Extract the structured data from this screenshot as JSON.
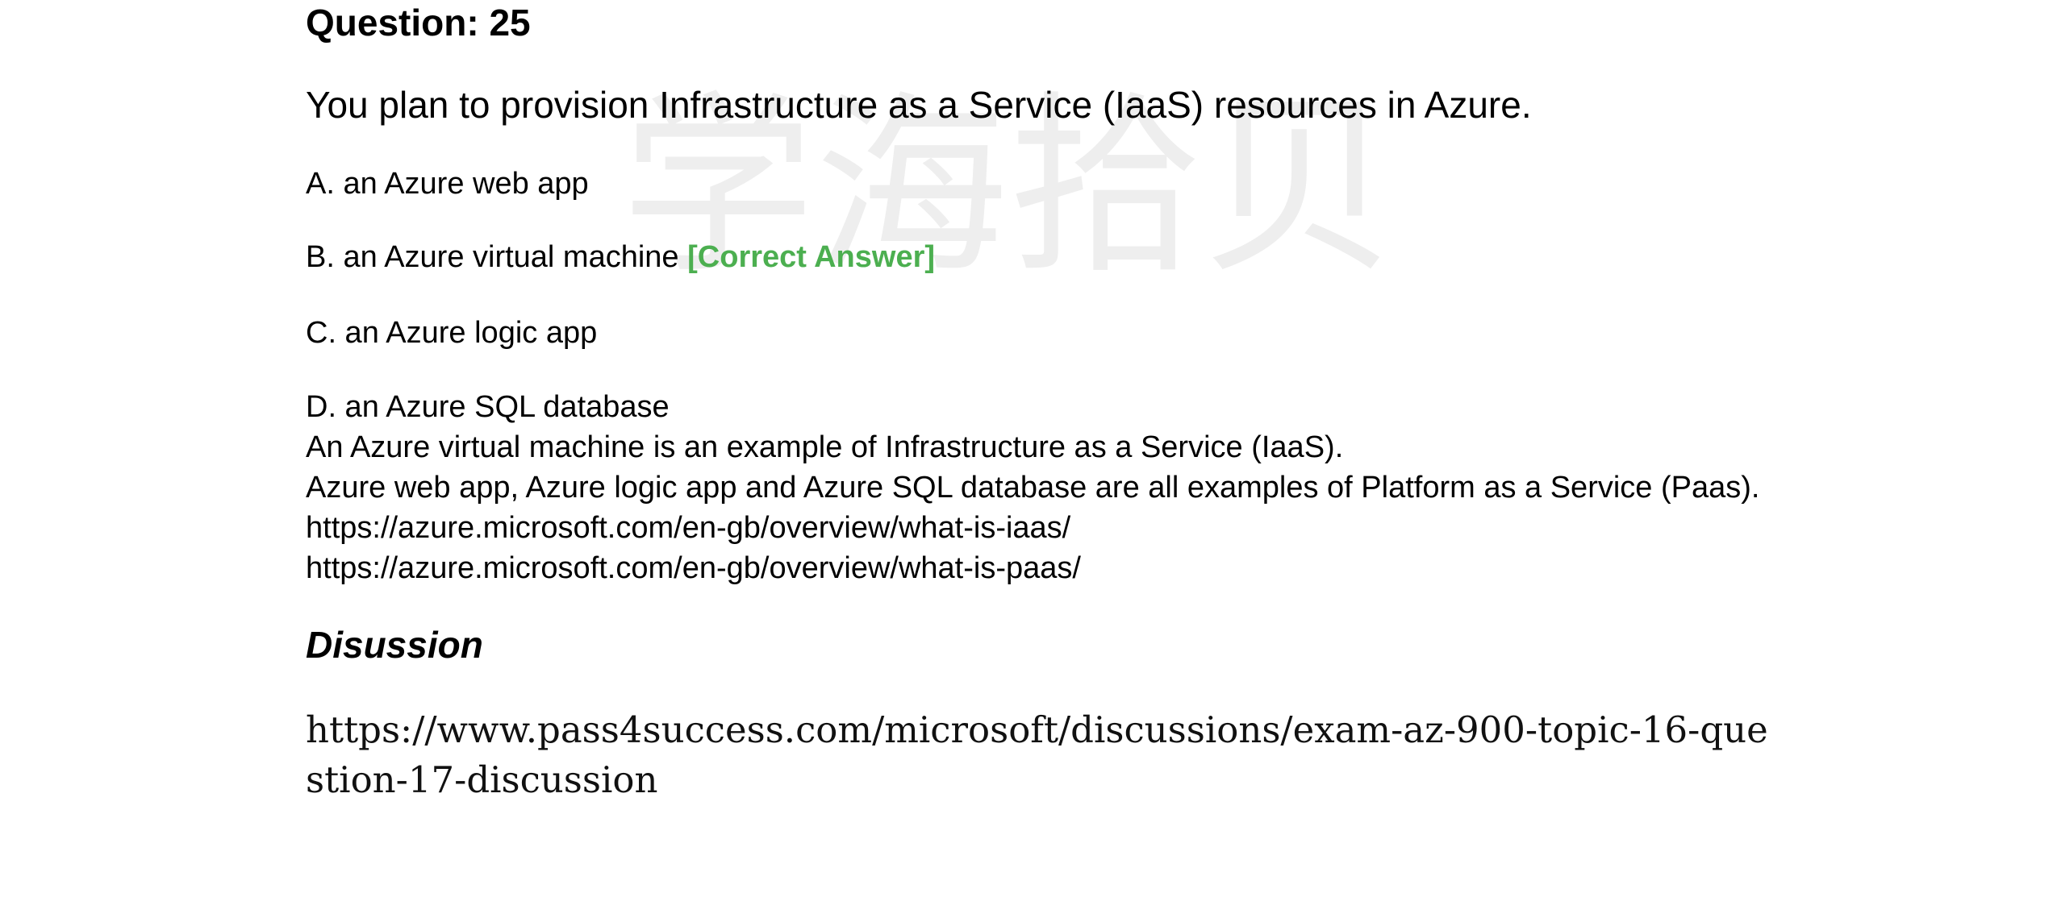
{
  "question": {
    "title": "Question: 25",
    "stem": "You plan to provision Infrastructure as a Service (IaaS) resources in Azure."
  },
  "options": [
    {
      "text": "A. an Azure web app"
    },
    {
      "text": "B. an Azure virtual machine",
      "badge": "[Correct Answer]"
    },
    {
      "text": "C. an Azure logic app"
    },
    {
      "text": "D. an Azure SQL database"
    }
  ],
  "explanation": {
    "lines": [
      "An Azure virtual machine is an example of Infrastructure as a Service (IaaS).",
      "Azure web app, Azure logic app and Azure SQL database are all examples of Platform as a Service (Paas).",
      "https://azure.microsoft.com/en-gb/overview/what-is-iaas/",
      "https://azure.microsoft.com/en-gb/overview/what-is-paas/"
    ]
  },
  "discussion": {
    "heading": "Disussion",
    "link": "https://www.pass4success.com/microsoft/discussions/exam-az-900-topic-16-question-17-discussion"
  },
  "watermark": {
    "text": "学海拾贝",
    "color": "#e8e8e8"
  },
  "colors": {
    "correct_answer": "#4caf50",
    "text": "#000000"
  }
}
